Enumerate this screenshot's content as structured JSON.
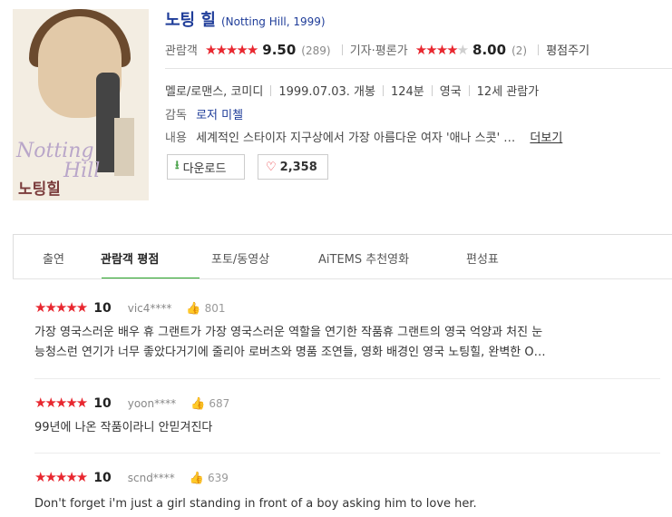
{
  "movie": {
    "title_ko": "노팅 힐",
    "title_en": "(Notting Hill, 1999)",
    "poster_title_1": "Notting",
    "poster_title_2": "Hill",
    "poster_title_ko": "노팅힐"
  },
  "ratings": {
    "audience_label": "관람객",
    "audience_score": "9.50",
    "audience_count": "(289)",
    "audience_stars": 5,
    "critic_label": "기자·평론가",
    "critic_score": "8.00",
    "critic_count": "(2)",
    "critic_stars": 4,
    "rate_link": "평점주기"
  },
  "info": {
    "genre": "멜로/로맨스, 코미디",
    "release": "1999.07.03. 개봉",
    "runtime": "124분",
    "country": "영국",
    "age": "12세 관람가",
    "director_label": "감독",
    "director": "로저 미첼",
    "plot_label": "내용",
    "plot": "세계적인 스타이자 지구상에서 가장 아름다운 여자 '애나 스콧' …",
    "more_link": "더보기"
  },
  "buttons": {
    "download": "다운로드",
    "likes": "2,358"
  },
  "tabs": [
    "출연",
    "관람객 평점",
    "포토/동영상",
    "AiTEMS 추천영화",
    "편성표"
  ],
  "active_tab": "관람객 평점",
  "reviews": [
    {
      "score": "10",
      "user": "vic4****",
      "likes": "801",
      "text_1": "가장 영국스러운 배우 휴 그랜트가 가장 영국스러운 역할을 연기한 작품휴 그랜트의 영국 억양과 처진 눈",
      "text_2": "능청스런 연기가 너무 좋았다거기에 줄리아 로버츠와 명품 조연들, 영화 배경인 영국 노팅힐, 완벽한 O…"
    },
    {
      "score": "10",
      "user": "yoon****",
      "likes": "687",
      "text_1": "99년에 나온 작품이라니 안믿겨진다",
      "text_2": ""
    },
    {
      "score": "10",
      "user": "scnd****",
      "likes": "639",
      "text_1": "Don't forget i'm just a girl standing in front of a boy asking him to love her.",
      "text_2": ""
    }
  ],
  "icons": [
    "download-icon",
    "heart-icon",
    "thumbs-up-icon",
    "star-icon"
  ],
  "colors": {
    "star": "#e8272f",
    "title": "#1f3d99",
    "tab_accent": "#2aa52a"
  }
}
